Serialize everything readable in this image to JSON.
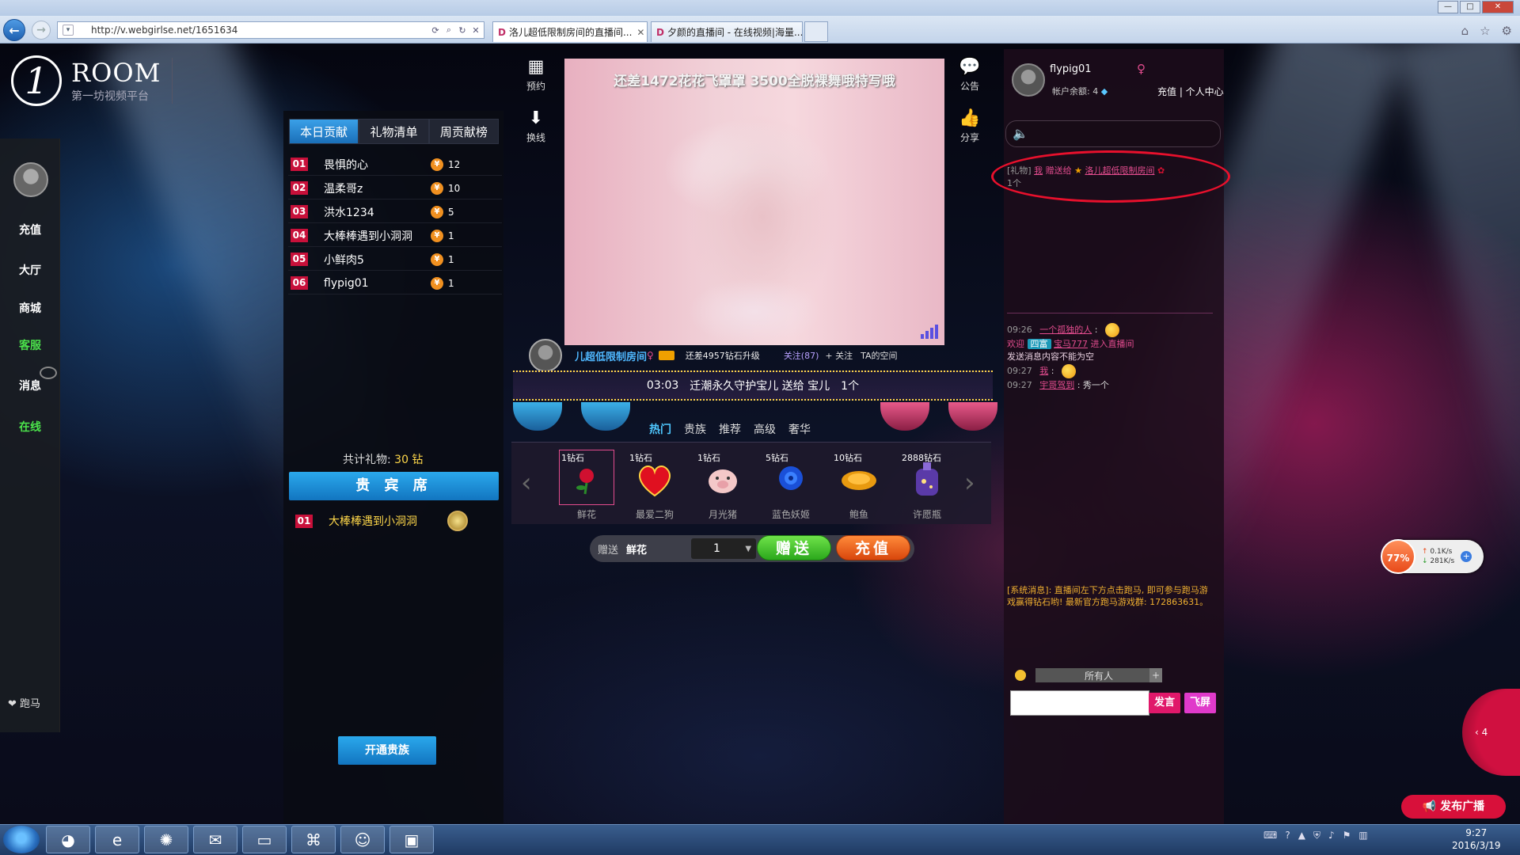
{
  "browser": {
    "url": "http://v.webgirlse.net/1651634",
    "tabs": [
      {
        "title": "洛儿超低限制房间的直播间...",
        "active": true
      },
      {
        "title": "夕颜的直播间 - 在线视频|海量..."
      }
    ]
  },
  "logo": {
    "title": "ROOM",
    "subtitle": "第一坊视频平台"
  },
  "left_nav": {
    "items": [
      "充值",
      "大厅",
      "商城",
      "客服",
      "消息",
      "在线"
    ],
    "bottom": "跑马"
  },
  "ranking": {
    "tabs": [
      "本日贡献",
      "礼物清单",
      "周贡献榜"
    ],
    "rows": [
      {
        "rank": "01",
        "name": "畏惧的心",
        "value": "12"
      },
      {
        "rank": "02",
        "name": "温柔哥z",
        "value": "10"
      },
      {
        "rank": "03",
        "name": "洪水1234",
        "value": "5"
      },
      {
        "rank": "04",
        "name": "大棒棒遇到小洞洞",
        "value": "1"
      },
      {
        "rank": "05",
        "name": "小鲜肉5",
        "value": "1"
      },
      {
        "rank": "06",
        "name": "flypig01",
        "value": "1"
      }
    ],
    "gift_total_label": "共计礼物:",
    "gift_total_value": "30 钻",
    "vip_title": "贵 宾 席",
    "vip_row": {
      "rank": "01",
      "name": "大棒棒遇到小洞洞"
    },
    "open_vip": "开通贵族"
  },
  "tools": {
    "book": "预约",
    "switch": "换线",
    "notice": "公告",
    "share": "分享"
  },
  "video": {
    "caption": "还差1472花花飞罩罩 3500全脱裸舞哦特写哦"
  },
  "host": {
    "name": "儿超低限制房间",
    "upgrade": "还差4957钻石升级",
    "follow": "关注(87)",
    "follow_btn": "+ 关注",
    "space": "TA的空间"
  },
  "marquee": {
    "time": "03:03",
    "text": "迁潮永久守护宝儿 送给 宝儿",
    "count": "1个"
  },
  "gift_tabs": [
    "热门",
    "贵族",
    "推荐",
    "高级",
    "奢华"
  ],
  "gifts": [
    {
      "price": "1钻石",
      "name": "鲜花",
      "icon": "rose-icon",
      "selected": true
    },
    {
      "price": "1钻石",
      "name": "最爱二狗",
      "icon": "heart-icon"
    },
    {
      "price": "1钻石",
      "name": "月光猪",
      "icon": "pig-icon"
    },
    {
      "price": "5钻石",
      "name": "蓝色妖姬",
      "icon": "blue-rose-icon"
    },
    {
      "price": "10钻石",
      "name": "鲍鱼",
      "icon": "abalone-icon"
    },
    {
      "price": "2888钻石",
      "name": "许愿瓶",
      "icon": "wish-bottle-icon"
    }
  ],
  "send": {
    "label": "赠送",
    "gift": "鲜花",
    "qty": "1",
    "send_btn": "赠送",
    "recharge_btn": "充值"
  },
  "user": {
    "name": "flypig01",
    "balance_label": "帐户余额: 4",
    "links": "充值 | 个人中心"
  },
  "gift_msg": {
    "tag": "[礼物]",
    "from": "我",
    "action": "赠送给",
    "to": "洛儿超低限制房间",
    "count": "1个"
  },
  "chat": [
    {
      "time": "09:26",
      "who": "一个孤独的人",
      "sep": ":"
    },
    {
      "welcome_prefix": "欢迎",
      "badge": "四富",
      "name": "宝马777",
      "suffix": "进入直播间"
    },
    {
      "warn": "发送消息内容不能为空"
    },
    {
      "time": "09:27",
      "who": "我",
      "sep": ":"
    },
    {
      "time": "09:27",
      "who": "宇哥驾到",
      "sep": ":",
      "msg": "秀一个"
    }
  ],
  "system_msg": "[系统消息]: 直播间左下方点击跑马, 即可参与跑马游戏赢得钻石哟! 最新官方跑马游戏群: 172863631。",
  "chat_input": {
    "recipient": "所有人",
    "placeholder": "",
    "speak": "发言",
    "fly": "飞屏"
  },
  "speed": {
    "pct": "77%",
    "up": "0.1K/s",
    "down": "281K/s"
  },
  "side_tab": "4",
  "broadcast": "发布广播",
  "taskbar": {
    "time": "9:27",
    "date": "2016/3/19"
  },
  "colors": {
    "accent_blue": "#1a6fb8",
    "accent_pink": "#e0186a",
    "rank_red": "#c8103a",
    "highlight_red": "#e8102c"
  }
}
